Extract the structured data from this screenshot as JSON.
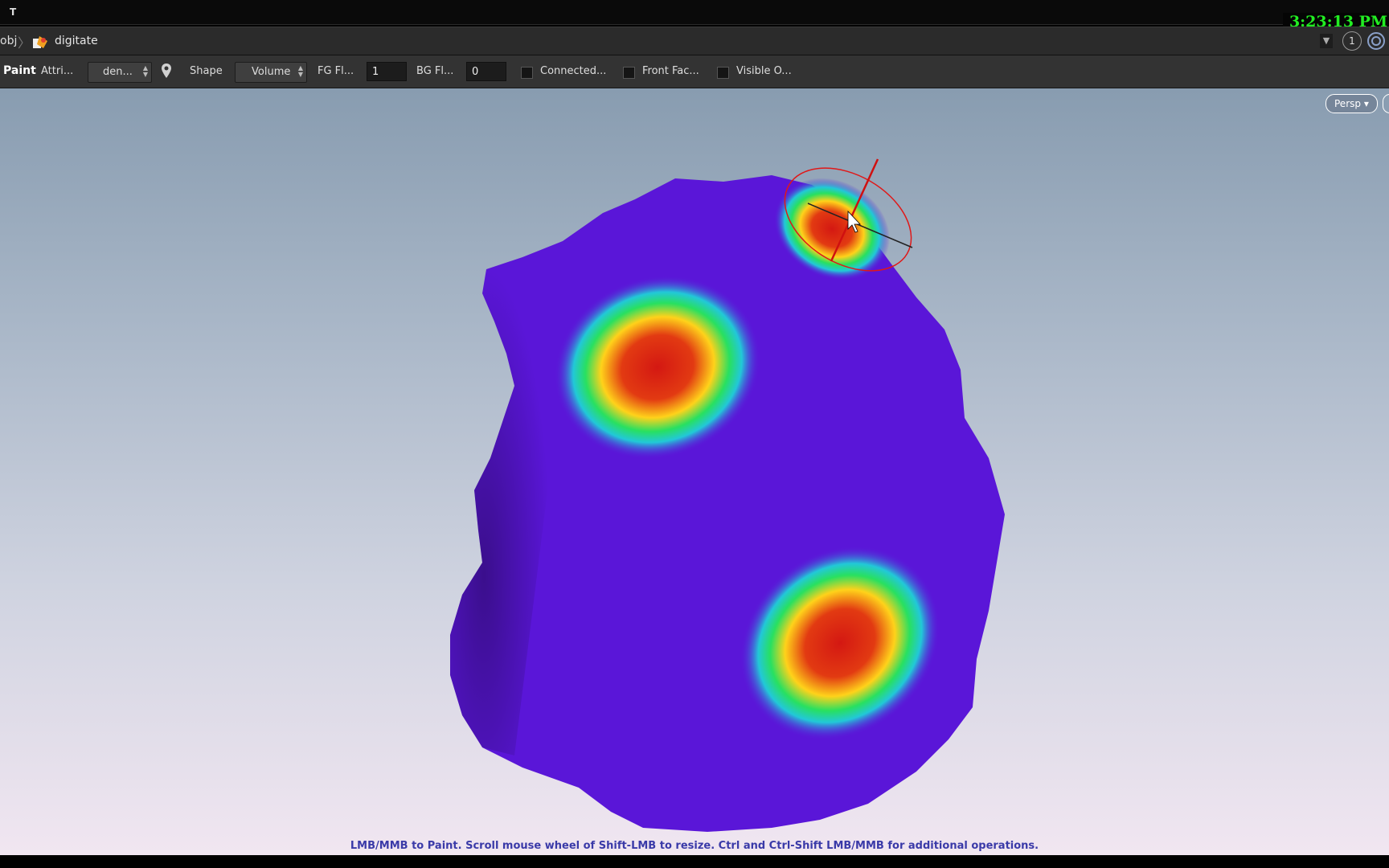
{
  "topbar": {
    "menu_mark": "T",
    "clock": "3:23:13 PM"
  },
  "pathbar": {
    "root": "obj",
    "node": "digitate",
    "dropdown_arrow": "▼",
    "desktop_number": "1",
    "node_icon": "houdini-node-icon",
    "ring_icon": "network-ring-icon"
  },
  "toolbar": {
    "title": "Paint",
    "attribute_label": "Attri...",
    "attribute_value": "den...",
    "pin_icon": "location-pin-icon",
    "shape_label": "Shape",
    "shape_value": "Volume",
    "fg_label": "FG Fl...",
    "fg_value": "1",
    "bg_label": "BG Fl...",
    "bg_value": "0",
    "connected_label": "Connected...",
    "front_facing_label": "Front Fac...",
    "visible_only_label": "Visible O..."
  },
  "viewport": {
    "camera_menu": "Persp",
    "status_message": "LMB/MMB to Paint.  Scroll mouse wheel of Shift-LMB to resize.  Ctrl and Ctrl-Shift LMB/MMB for additional operations."
  },
  "colors": {
    "mesh_base": "#5a16d8",
    "heat_hot": "#d81a10",
    "heat_warm": "#ffd21a",
    "heat_cool": "#22d0d0",
    "brush_ring": "#e01818",
    "clock_text": "#22ee22"
  }
}
